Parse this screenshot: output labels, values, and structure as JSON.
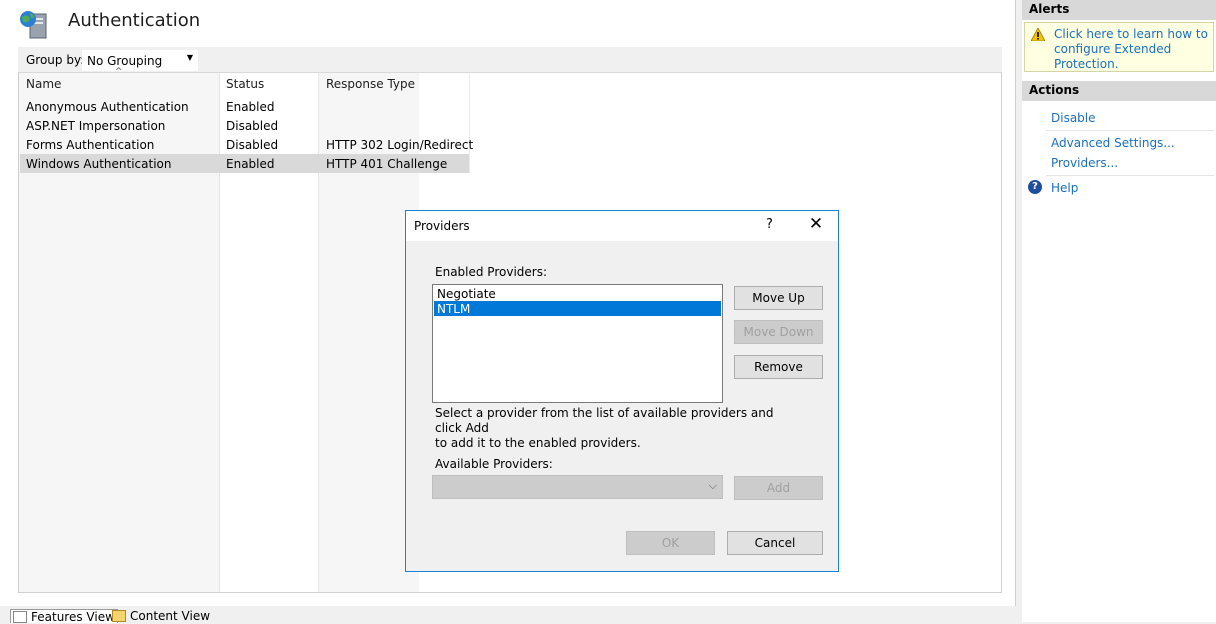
{
  "main": {
    "title": "Authentication",
    "group_by": {
      "label": "Group by:",
      "value": "No Grouping"
    },
    "columns": [
      "Name",
      "Status",
      "Response Type"
    ],
    "rows": [
      {
        "name": "Anonymous Authentication",
        "status": "Enabled",
        "response": ""
      },
      {
        "name": "ASP.NET Impersonation",
        "status": "Disabled",
        "response": ""
      },
      {
        "name": "Forms Authentication",
        "status": "Disabled",
        "response": "HTTP 302 Login/Redirect"
      },
      {
        "name": "Windows Authentication",
        "status": "Enabled",
        "response": "HTTP 401 Challenge",
        "selected": true
      }
    ]
  },
  "bottom_tabs": [
    "Features View",
    "Content View"
  ],
  "alerts": {
    "header": "Alerts",
    "text": "Click here to learn how to configure Extended Protection."
  },
  "actions": {
    "header": "Actions",
    "items": [
      "Disable",
      "Advanced Settings...",
      "Providers...",
      "Help"
    ]
  },
  "dialog": {
    "title": "Providers",
    "help_glyph": "?",
    "close_glyph": "✕",
    "enabled_label": "Enabled Providers:",
    "enabled_items": [
      {
        "label": "Negotiate",
        "selected": false
      },
      {
        "label": "NTLM",
        "selected": true
      }
    ],
    "move_up": "Move Up",
    "move_down": "Move Down",
    "remove": "Remove",
    "hint_line1": "Select a provider from the list of available providers and click Add",
    "hint_line2": "to add it to the enabled providers.",
    "available_label": "Available Providers:",
    "available_value": "",
    "add": "Add",
    "ok": "OK",
    "cancel": "Cancel"
  },
  "colors": {
    "accent": "#0078d7",
    "link": "#1a6fc2",
    "alert_bg": "#ffffe1",
    "selected_row": "#d9d9d9"
  }
}
